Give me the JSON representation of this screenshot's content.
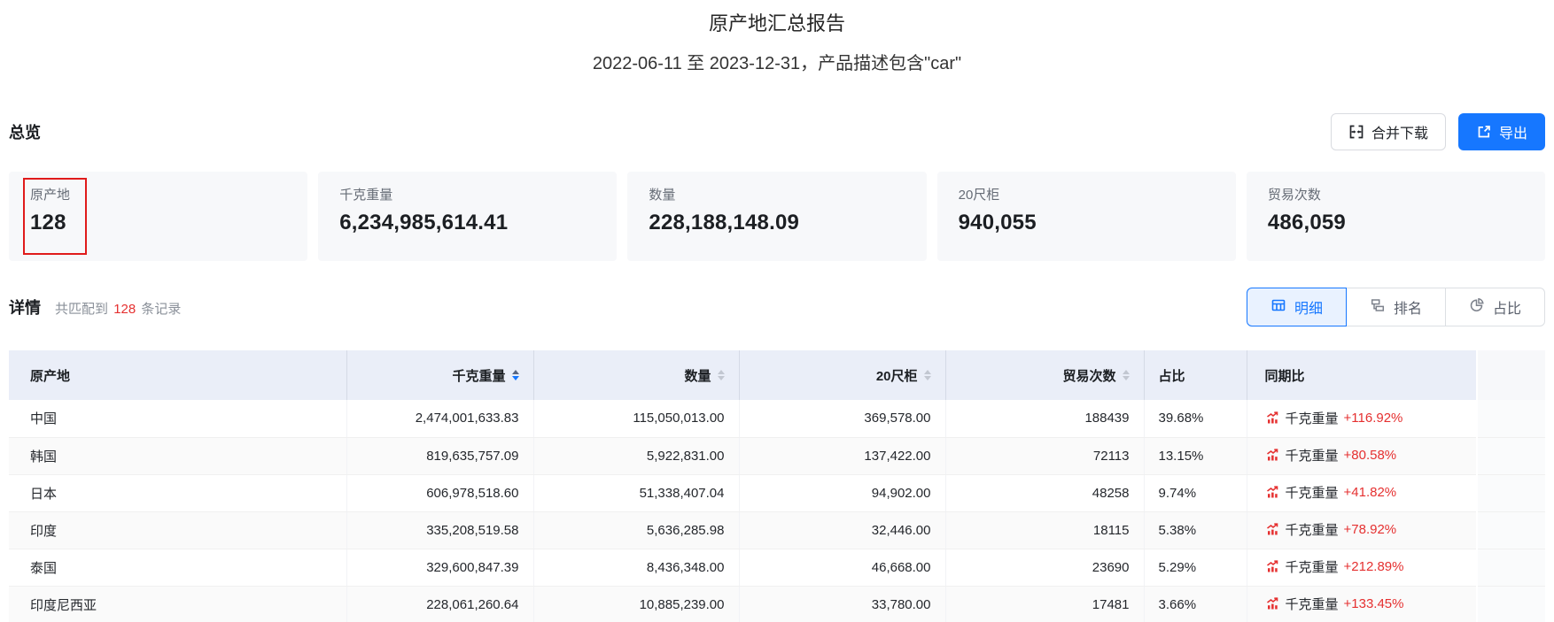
{
  "report": {
    "title": "原产地汇总报告",
    "subtitle": "2022-06-11 至 2023-12-31，产品描述包含\"car\""
  },
  "overview": {
    "heading": "总览",
    "merge_download_label": "合并下载",
    "export_label": "导出",
    "cards": [
      {
        "label": "原产地",
        "value": "128",
        "highlighted": true
      },
      {
        "label": "千克重量",
        "value": "6,234,985,614.41"
      },
      {
        "label": "数量",
        "value": "228,188,148.09"
      },
      {
        "label": "20尺柜",
        "value": "940,055"
      },
      {
        "label": "贸易次数",
        "value": "486,059"
      }
    ]
  },
  "details": {
    "heading": "详情",
    "match_prefix": "共匹配到",
    "match_count": "128",
    "match_suffix": "条记录",
    "tabs": [
      {
        "label": "明细",
        "icon": "table-icon",
        "selected": true
      },
      {
        "label": "排名",
        "icon": "ranking-icon",
        "selected": false
      },
      {
        "label": "占比",
        "icon": "pie-icon",
        "selected": false
      }
    ]
  },
  "table": {
    "columns": [
      {
        "label": "原产地",
        "sortable": false,
        "align": "left"
      },
      {
        "label": "千克重量",
        "sortable": true,
        "sort": "desc",
        "align": "right"
      },
      {
        "label": "数量",
        "sortable": true,
        "sort": null,
        "align": "right"
      },
      {
        "label": "20尺柜",
        "sortable": true,
        "sort": null,
        "align": "right"
      },
      {
        "label": "贸易次数",
        "sortable": true,
        "sort": null,
        "align": "right"
      },
      {
        "label": "占比",
        "sortable": false,
        "align": "left"
      },
      {
        "label": "同期比",
        "sortable": false,
        "align": "left"
      },
      {
        "label": "",
        "sortable": false,
        "align": "left"
      }
    ],
    "rows": [
      {
        "origin": "中国",
        "weight": "2,474,001,633.83",
        "quantity": "115,050,013.00",
        "teu": "369,578.00",
        "trades": "188439",
        "share": "39.68%",
        "yoy_metric": "千克重量",
        "yoy_value": "+116.92%"
      },
      {
        "origin": "韩国",
        "weight": "819,635,757.09",
        "quantity": "5,922,831.00",
        "teu": "137,422.00",
        "trades": "72113",
        "share": "13.15%",
        "yoy_metric": "千克重量",
        "yoy_value": "+80.58%"
      },
      {
        "origin": "日本",
        "weight": "606,978,518.60",
        "quantity": "51,338,407.04",
        "teu": "94,902.00",
        "trades": "48258",
        "share": "9.74%",
        "yoy_metric": "千克重量",
        "yoy_value": "+41.82%"
      },
      {
        "origin": "印度",
        "weight": "335,208,519.58",
        "quantity": "5,636,285.98",
        "teu": "32,446.00",
        "trades": "18115",
        "share": "5.38%",
        "yoy_metric": "千克重量",
        "yoy_value": "+78.92%"
      },
      {
        "origin": "泰国",
        "weight": "329,600,847.39",
        "quantity": "8,436,348.00",
        "teu": "46,668.00",
        "trades": "23690",
        "share": "5.29%",
        "yoy_metric": "千克重量",
        "yoy_value": "+212.89%"
      },
      {
        "origin": "印度尼西亚",
        "weight": "228,061,260.64",
        "quantity": "10,885,239.00",
        "teu": "33,780.00",
        "trades": "17481",
        "share": "3.66%",
        "yoy_metric": "千克重量",
        "yoy_value": "+133.45%"
      }
    ]
  },
  "colors": {
    "accent_blue": "#1677ff",
    "alert_red": "#e53030",
    "highlight_box_red": "#e01b1b",
    "table_header_bg": "#eaeef8",
    "card_bg": "#f7f8fa",
    "stripe_bg": "#fafafa"
  }
}
